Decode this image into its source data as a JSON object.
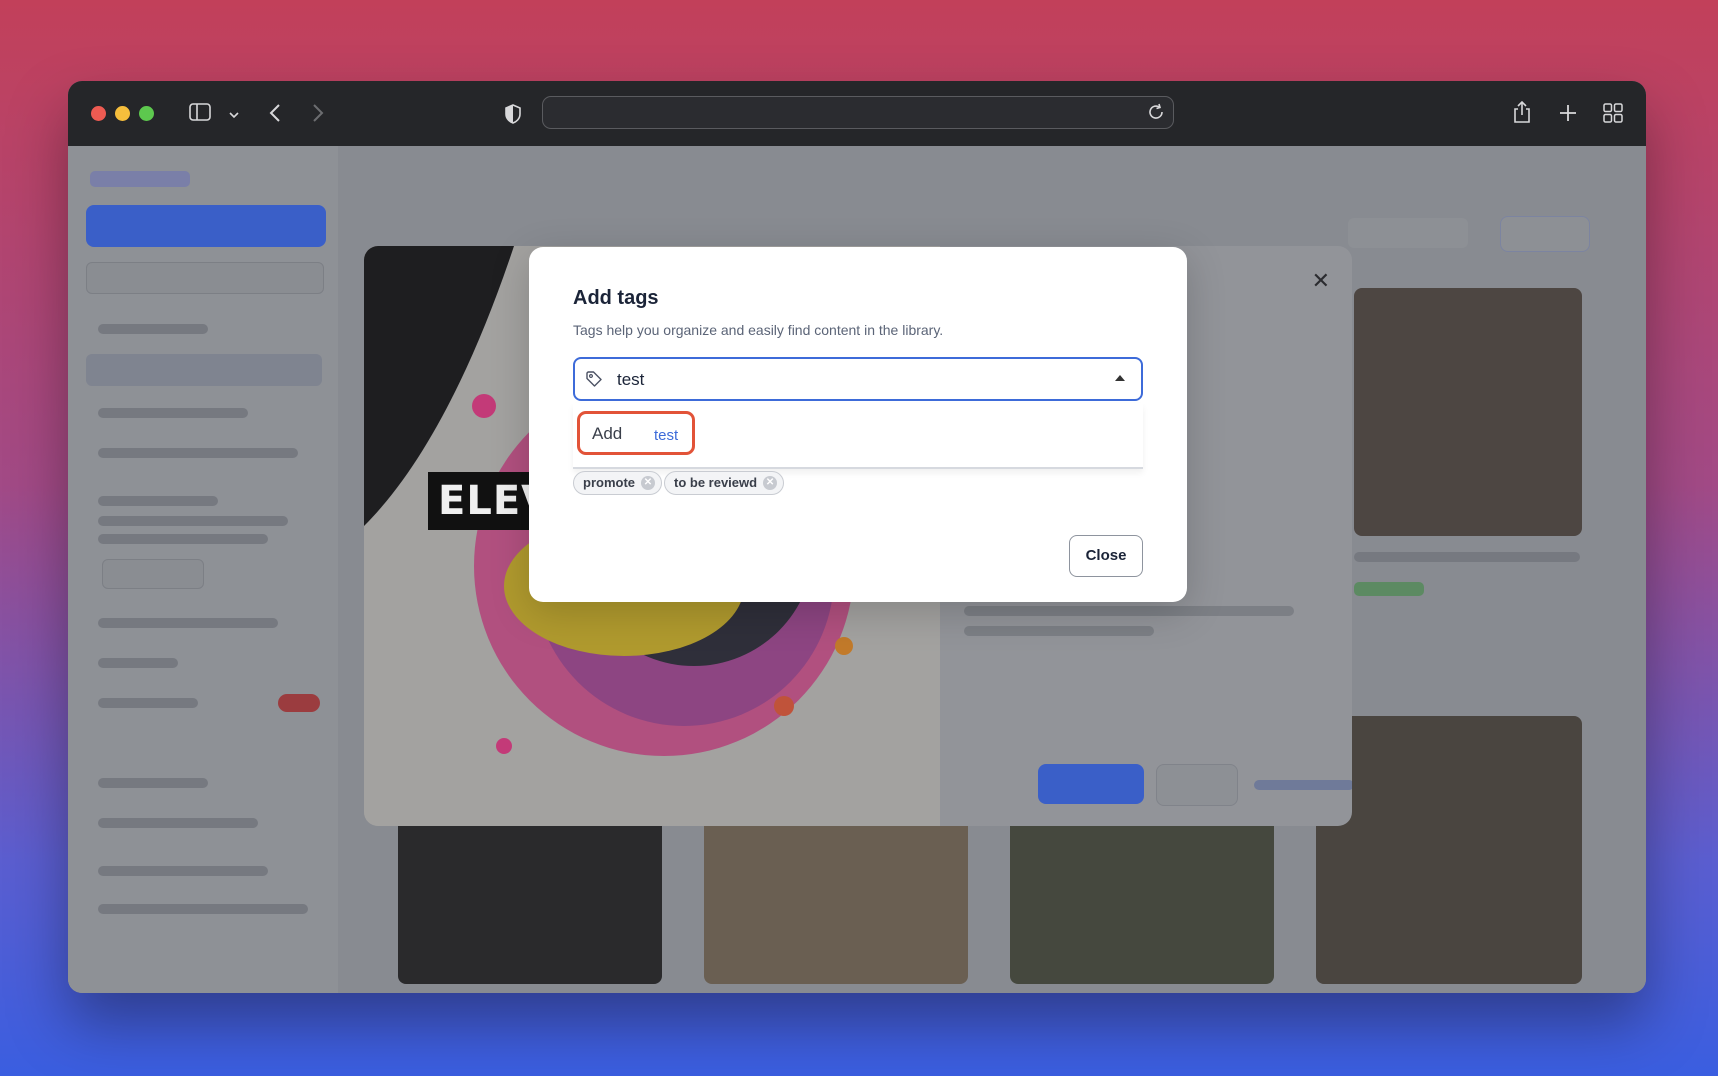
{
  "browser": {
    "address": "",
    "icons": [
      "sidebar-icon",
      "chevron-down-icon",
      "back-icon",
      "forward-icon",
      "shield-icon",
      "reload-icon",
      "share-icon",
      "new-tab-icon",
      "tab-overview-icon"
    ]
  },
  "background_content": {
    "detail_image_text": "ELEV"
  },
  "modal": {
    "title": "Add tags",
    "subtitle": "Tags help you organize and easily find content in the library.",
    "input_value": "test",
    "dropdown_option": {
      "prefix": "Add",
      "value": "test"
    },
    "tags": [
      {
        "label": "promote"
      },
      {
        "label": "to be reviewd"
      }
    ],
    "close_label": "Close"
  },
  "colors": {
    "accent": "#3d6bd9",
    "highlight": "#e25338"
  }
}
